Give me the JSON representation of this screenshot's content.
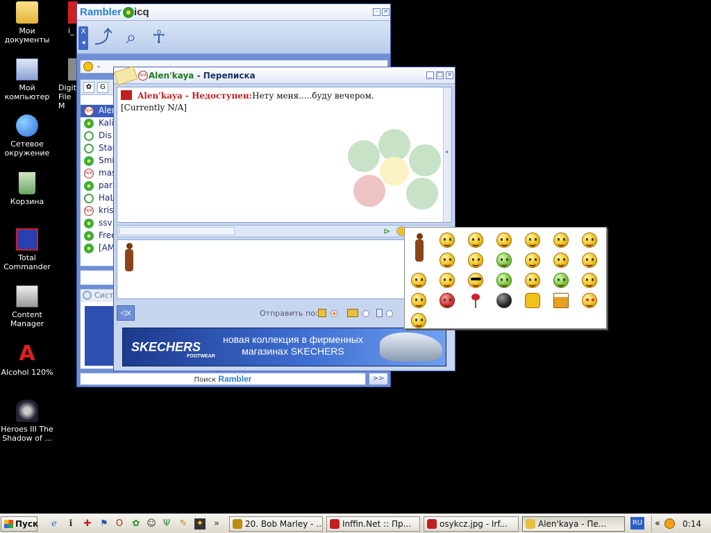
{
  "desktop": {
    "icons": [
      {
        "label": "Мои документы",
        "icon": "folder-icon"
      },
      {
        "label": "Мой компьютер",
        "icon": "computer-icon"
      },
      {
        "label": "Сетевое окружение",
        "icon": "network-icon"
      },
      {
        "label": "Корзина",
        "icon": "recycle-bin-icon"
      },
      {
        "label": "Total Commander",
        "icon": "floppy-icon"
      },
      {
        "label": "Content Manager",
        "icon": "phone-icon"
      },
      {
        "label": "Alcohol 120%",
        "icon": "alcohol-icon"
      },
      {
        "label": "Heroes III The Shadow of ...",
        "icon": "heroes-icon"
      }
    ],
    "partial_icons": [
      {
        "label": "i_",
        "icon": "partial-icon"
      },
      {
        "label": "Digit File M",
        "icon": "partial-icon"
      }
    ]
  },
  "rambler_window": {
    "logo_rambler": "Rambler",
    "logo_icq": "icq",
    "minimize_label": "–",
    "close_label": "×",
    "toolbar_x": "X",
    "status_text": "-",
    "list_tab_g": "G",
    "contacts": [
      {
        "name": "Alen'kaya",
        "status": "na",
        "selected": true
      },
      {
        "name": "Kali",
        "status": "online"
      },
      {
        "name": "Dis",
        "status": "away"
      },
      {
        "name": "Star",
        "status": "away"
      },
      {
        "name": "Smi",
        "status": "online"
      },
      {
        "name": "mas",
        "status": "na"
      },
      {
        "name": "para",
        "status": "online"
      },
      {
        "name": "HaL",
        "status": "away"
      },
      {
        "name": "kris",
        "status": "na"
      },
      {
        "name": "ssv",
        "status": "online"
      },
      {
        "name": "Free",
        "status": "online"
      },
      {
        "name": "[AM",
        "status": "online"
      }
    ],
    "system_header": "Систе",
    "search_label": "Поиск",
    "search_brand": "Rambler",
    "search_go": ">>"
  },
  "chat_window": {
    "title_name": "Alen'kaya",
    "title_rest": " - Переписка",
    "na_badge": "N/A",
    "history": {
      "sender_status": "Alen'kaya - Недоступен:",
      "message": "Нету меня.....буду вечером.",
      "line2": "[Currently N/A]"
    },
    "back_button": "◁x",
    "send_via": "Отправить по:",
    "banner": {
      "brand": "SKECHERS",
      "brand_sub": "FOOTWEAR",
      "text": "новая коллекция в фирменных магазинах SKECHERS"
    }
  },
  "smiley_panel": {
    "rows": 5,
    "cols": 7
  },
  "taskbar": {
    "start_label": "Пуск",
    "quicklaunch_more": "»",
    "tasks": [
      {
        "label": "20. Bob Marley - ...",
        "icon": "winamp-icon"
      },
      {
        "label": "Inffin.Net :: Пр...",
        "icon": "opera-icon"
      },
      {
        "label": "osykcz.jpg - Irf...",
        "icon": "irfanview-icon"
      },
      {
        "label": "Alen'kaya - Пе...",
        "icon": "note-icon",
        "active": true
      }
    ],
    "language": "RU",
    "tray_arrow": "«",
    "clock": "0:14"
  }
}
